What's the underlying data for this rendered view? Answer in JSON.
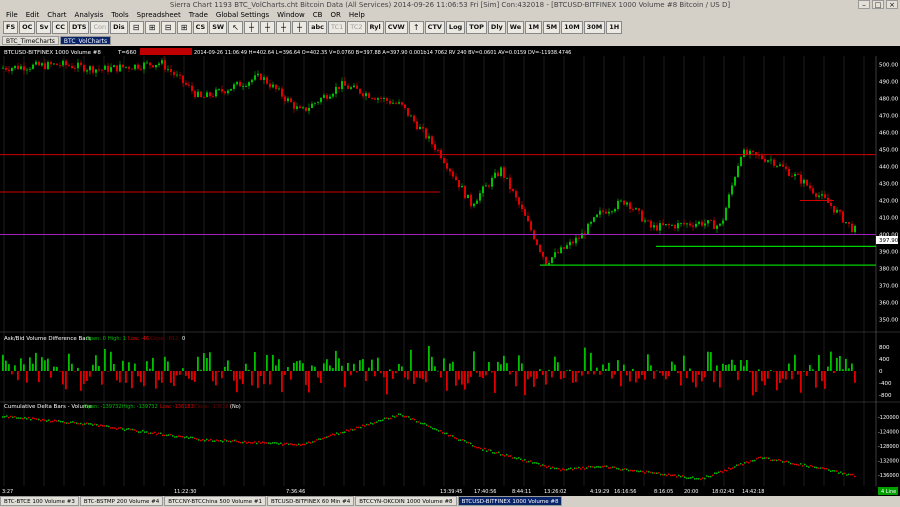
{
  "window": {
    "title": "Sierra Chart 1193 BTC_VolCharts.cht  Bitcoin Data (All Services) 2014-09-26  11:06:53 Fri [Sim]  Con:432018 - [BTCUSD-BITFINEX  1000 Volume  #8  Bitcoin / US D]"
  },
  "menu": [
    "File",
    "Edit",
    "Chart",
    "Analysis",
    "Tools",
    "Spreadsheet",
    "Trade",
    "Global Settings",
    "Window",
    "CB",
    "OR",
    "Help"
  ],
  "toolbar": {
    "buttons": [
      "FS",
      "OC",
      "Sv",
      "CC",
      "DTS",
      "Con",
      "Dis",
      "",
      "",
      "",
      "",
      "CS",
      "SW",
      "",
      "",
      "",
      "",
      "",
      "abc",
      "TC1",
      "TC2",
      "Ryl",
      "CVW",
      "",
      "CTV",
      "Log",
      "TOP",
      "Dly",
      "We",
      "1M",
      "5M",
      "10M",
      "30M",
      "1H"
    ]
  },
  "chartbar": {
    "tabs": [
      "BTC_TimeCharts",
      "BTC_VolCharts"
    ],
    "active": 1
  },
  "chart": {
    "header_symbol": "BTCUSD-BITFINEX  1000 Volume  #8",
    "header_t": "T=660",
    "header_stats": "2014-09-26 11:06:49 H=402.64 L=396.64 O=402.35 V=0.0760 B=397.88 A=397.90 0.001b14 7062 RV 240 BV=0.0601 AV=0.0159 DV=-11938.4746",
    "price_axis": [
      "500.00",
      "490.00",
      "480.00",
      "470.00",
      "460.00",
      "450.00",
      "440.00",
      "430.00",
      "420.00",
      "410.00",
      "400.00",
      "390.00",
      "380.00",
      "370.00",
      "360.00",
      "350.00"
    ],
    "last_price": "397.90",
    "study1_title": "Ask/Bid Volume Difference Bars",
    "study1_open": "Open: 0",
    "study1_high": "High: 1",
    "study1_low": "Low: -46",
    "study1_last": "Close: -612",
    "study1_zero": "0",
    "study1_axis": [
      "800",
      "400",
      "0",
      "-400",
      "-800"
    ],
    "study2_title": "Cumulative Delta Bars - Volume",
    "study2_open": "Open: -139732",
    "study2_high": "High: -139732",
    "study2_low": "Low: -136183",
    "study2_last": "Close: -136183",
    "study2_flag": "(No)",
    "study2_axis": [
      "-120000",
      "-124000",
      "-128000",
      "-132000",
      "-136000"
    ],
    "time_labels": [
      "3:27",
      "11:22:30",
      "7:36:46",
      "13:39:45",
      "17:40:56",
      "8:44:11",
      "13:26:02",
      "4:19:29",
      "16:16:56",
      "8:16:05",
      "20:00",
      "18:02:43",
      "14:42:18"
    ],
    "scroll_label": "4 Line"
  },
  "bottom_tabs": [
    "BTC-BTCE  100 Volume  #3",
    "BTC-BSTMP  200 Volume  #4",
    "BTCCNY-BTCChina  500 Volume  #1",
    "BTCUSD-BITFINEX  60 Min  #4",
    "BTCCYN-OKCOIN  1000 Volume  #8",
    "BTCUSD-BITFINEX  1000 Volume  #8"
  ],
  "bottom_active": 5,
  "colors": {
    "up": "#00c000",
    "down": "#e00000",
    "hline_red": "#d00000",
    "hline_purple": "#a020c0",
    "hline_green": "#00d000"
  }
}
